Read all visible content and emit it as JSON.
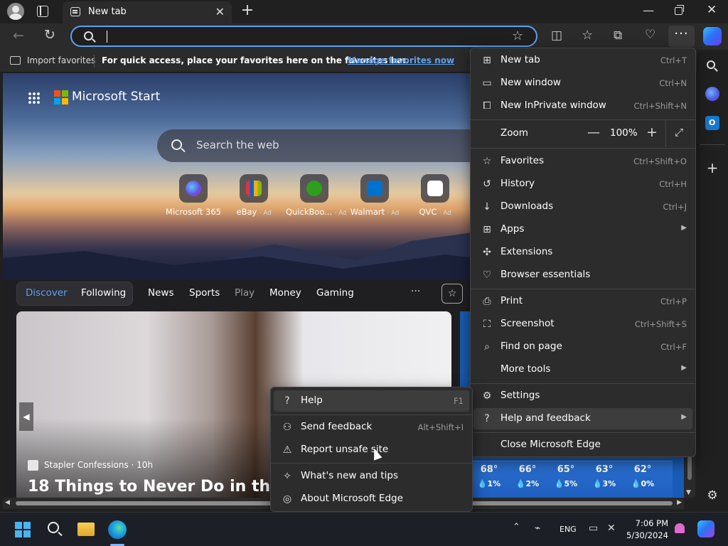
{
  "titlebar": {
    "tab_title": "New tab",
    "tab_close": "✕",
    "new_tab": "+",
    "minimize": "—",
    "close": "✕"
  },
  "toolbar": {
    "back": "←",
    "refresh": "↻",
    "address_value": "",
    "favorite_star": "☆",
    "split_screen": "◫",
    "favorites": "☆",
    "collections": "⧉",
    "browser_essentials": "♡",
    "more": "···"
  },
  "favbar": {
    "import_label": "Import favorites",
    "message": "For quick access, place your favorites here on the favorites bar.",
    "link": "Manage favorites now"
  },
  "page": {
    "brand": "Microsoft Start",
    "search_placeholder": "Search the web",
    "quick_links": [
      {
        "label": "Microsoft 365",
        "ad": "",
        "color": "#7b4be0"
      },
      {
        "label": "eBay",
        "ad": "· Ad",
        "color": "#e53238"
      },
      {
        "label": "QuickBoo...",
        "ad": "· Ad",
        "color": "#2ca01c"
      },
      {
        "label": "Walmart",
        "ad": "· Ad",
        "color": "#0071ce"
      },
      {
        "label": "QVC",
        "ad": "· Ad",
        "color": "#ffffff"
      }
    ],
    "feed_tabs": {
      "discover": "Discover",
      "following": "Following",
      "news": "News",
      "sports": "Sports",
      "play": "Play",
      "money": "Money",
      "gaming": "Gaming",
      "more": "···"
    },
    "card": {
      "source": "Stapler Confessions · 10h",
      "title": "18 Things to Never Do in the Sh"
    },
    "weather": [
      {
        "temp": "68°",
        "pct": "💧1%"
      },
      {
        "temp": "66°",
        "pct": "💧2%"
      },
      {
        "temp": "65°",
        "pct": "💧5%"
      },
      {
        "temp": "63°",
        "pct": "💧3%"
      },
      {
        "temp": "62°",
        "pct": "💧0%"
      }
    ]
  },
  "menu": {
    "items": [
      {
        "label": "New tab",
        "shortcut": "Ctrl+T",
        "icon": "new-tab-icon"
      },
      {
        "label": "New window",
        "shortcut": "Ctrl+N",
        "icon": "new-window-icon"
      },
      {
        "label": "New InPrivate window",
        "shortcut": "Ctrl+Shift+N",
        "icon": "inprivate-icon"
      },
      {
        "label": "Favorites",
        "shortcut": "Ctrl+Shift+O",
        "icon": "favorites-icon"
      },
      {
        "label": "History",
        "shortcut": "Ctrl+H",
        "icon": "history-icon"
      },
      {
        "label": "Downloads",
        "shortcut": "Ctrl+J",
        "icon": "download-icon"
      },
      {
        "label": "Apps",
        "shortcut": "",
        "icon": "apps-icon"
      },
      {
        "label": "Extensions",
        "shortcut": "",
        "icon": "extensions-icon"
      },
      {
        "label": "Browser essentials",
        "shortcut": "",
        "icon": "heart-pulse-icon"
      },
      {
        "label": "Print",
        "shortcut": "Ctrl+P",
        "icon": "print-icon"
      },
      {
        "label": "Screenshot",
        "shortcut": "Ctrl+Shift+S",
        "icon": "screenshot-icon"
      },
      {
        "label": "Find on page",
        "shortcut": "Ctrl+F",
        "icon": "find-icon"
      },
      {
        "label": "More tools",
        "shortcut": "",
        "icon": ""
      },
      {
        "label": "Settings",
        "shortcut": "",
        "icon": "gear-icon"
      },
      {
        "label": "Help and feedback",
        "shortcut": "",
        "icon": "help-icon"
      },
      {
        "label": "Close Microsoft Edge",
        "shortcut": "",
        "icon": ""
      }
    ],
    "zoom": {
      "label": "Zoom",
      "minus": "—",
      "value": "100%",
      "plus": "+",
      "fullscreen": "⤢"
    }
  },
  "submenu": {
    "items": [
      {
        "label": "Help",
        "shortcut": "F1"
      },
      {
        "label": "Send feedback",
        "shortcut": "Alt+Shift+I"
      },
      {
        "label": "Report unsafe site",
        "shortcut": ""
      },
      {
        "label": "What's new and tips",
        "shortcut": ""
      },
      {
        "label": "About Microsoft Edge",
        "shortcut": ""
      }
    ]
  },
  "taskbar": {
    "language": "ENG",
    "time": "7:06 PM",
    "date": "5/30/2024"
  }
}
